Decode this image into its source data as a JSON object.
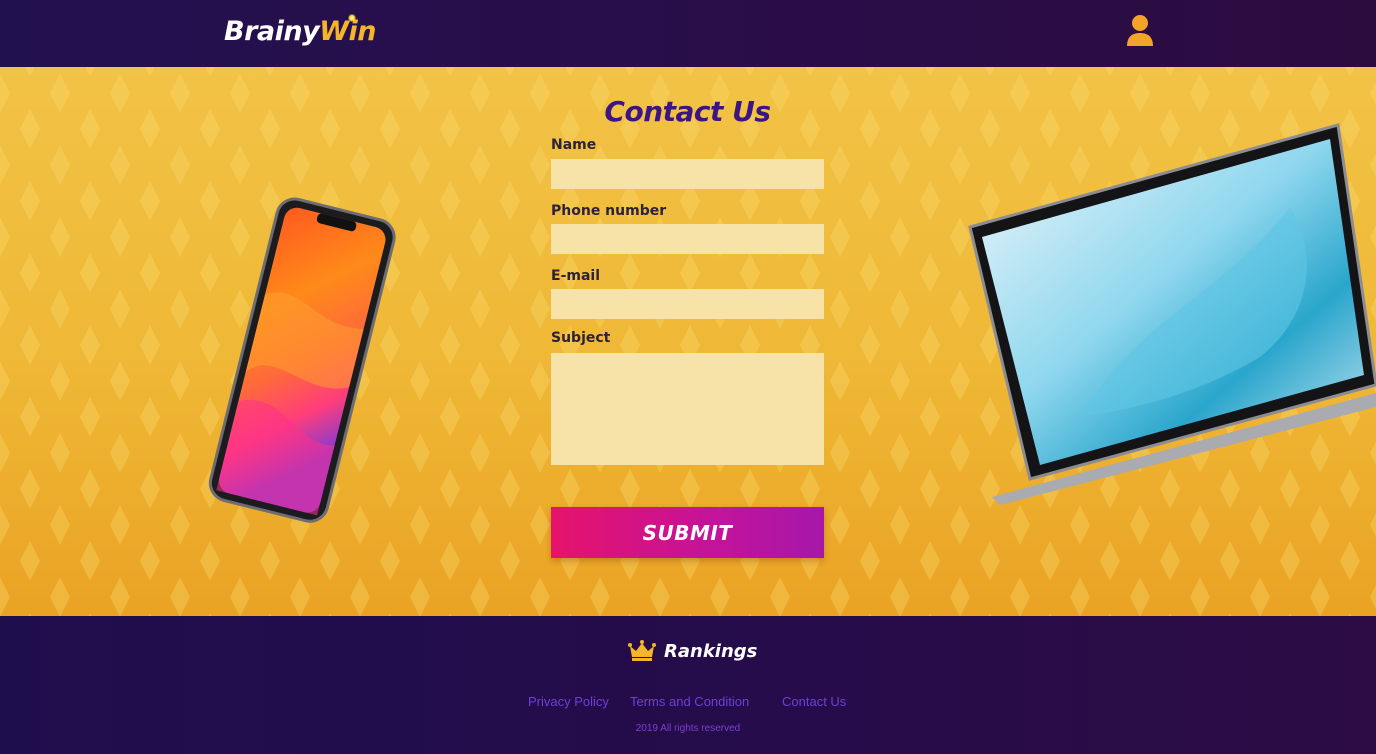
{
  "header": {
    "logo_part1": "Brainy",
    "logo_part2": "Win",
    "user_icon": "user-icon"
  },
  "contact_form": {
    "title": "Contact Us",
    "fields": [
      {
        "label": "Name",
        "value": ""
      },
      {
        "label": "Phone number",
        "value": ""
      },
      {
        "label": "E-mail",
        "value": ""
      },
      {
        "label": "Subject",
        "value": ""
      }
    ],
    "submit_label": "SUBMIT"
  },
  "images": {
    "left": "smartphone-image",
    "right": "laptop-image"
  },
  "footer": {
    "rankings_label": "Rankings",
    "rankings_icon": "crown-icon",
    "links": [
      "Privacy Policy",
      "Terms and Condition",
      "Contact Us"
    ],
    "copyright": "2019 All rights reserved"
  },
  "colors": {
    "header_bg": "#22114f",
    "accent_gold": "#f4b52a",
    "title_purple": "#3b1485",
    "submit_gradient_start": "#e6136b",
    "submit_gradient_end": "#a617a9",
    "footer_link": "#6f3fd7"
  }
}
